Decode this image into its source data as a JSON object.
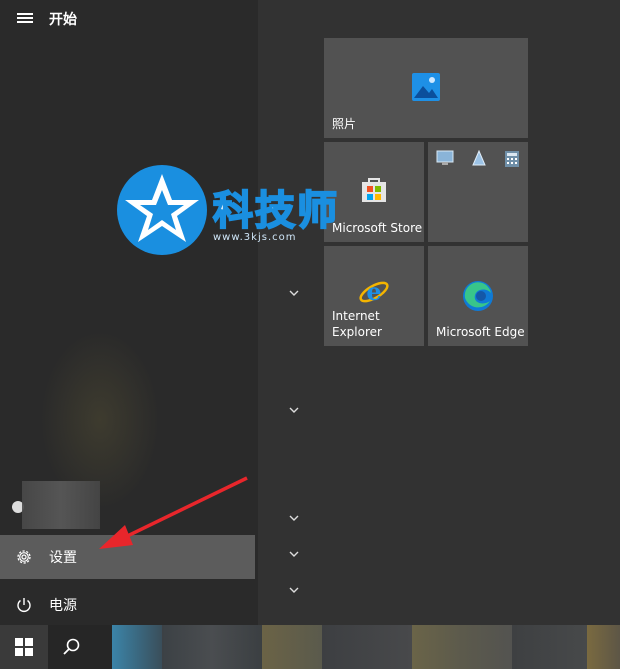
{
  "header": {
    "title": "开始",
    "menu_icon": "hamburger-icon"
  },
  "sidebar": {
    "settings_label": "设置",
    "power_label": "电源",
    "settings_icon": "gear-icon",
    "power_icon": "power-icon"
  },
  "tiles": {
    "photos": "照片",
    "store": "Microsoft Store",
    "ie_line1": "Internet",
    "ie_line2": "Explorer",
    "edge": "Microsoft Edge"
  },
  "watermark": {
    "text": "科技师",
    "url": "www.3kjs.com"
  },
  "colors": {
    "accent": "#1a8fe0",
    "arrow": "#e8262b",
    "tile": "#525252",
    "settings_highlight": "#5c5c5c"
  }
}
